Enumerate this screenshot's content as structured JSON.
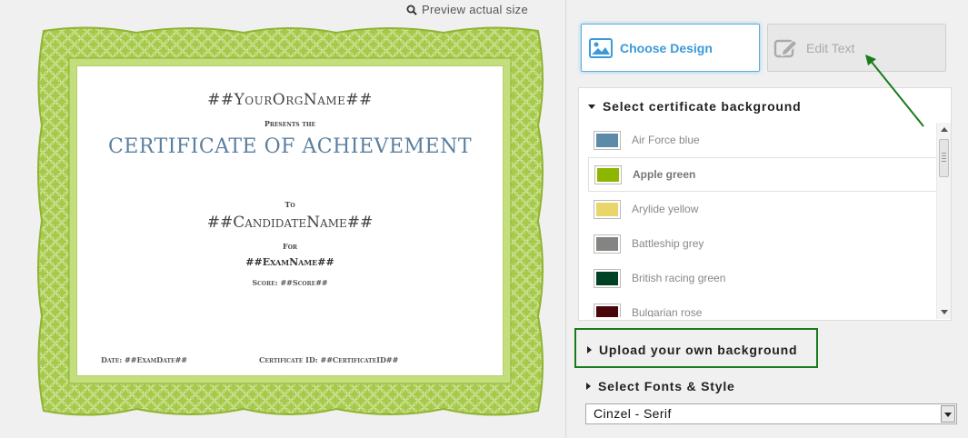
{
  "preview": {
    "link_label": "Preview actual size",
    "icon": "search-icon"
  },
  "certificate": {
    "org": "##YourOrgName##",
    "presents": "Presents the",
    "title": "Certificate of Achievement",
    "to": "To",
    "candidate": "##CandidateName##",
    "for": "For",
    "exam": "##ExamName##",
    "score": "Score: ##Score##",
    "date": "Date: ##ExamDate##",
    "certificate_id": "Certificate ID: ##CertificateID##",
    "border_color": "#9cc43a",
    "title_color": "#5b7fa0"
  },
  "toolbar": {
    "choose_design_label": "Choose Design",
    "choose_design_icon": "image-icon",
    "edit_text_label": "Edit Text",
    "edit_text_icon": "edit-icon"
  },
  "background_section": {
    "heading": "Select certificate background",
    "items": [
      {
        "label": "Air Force blue",
        "color": "#5d8aa8",
        "selected": false
      },
      {
        "label": "Apple green",
        "color": "#8db600",
        "selected": true
      },
      {
        "label": "Arylide yellow",
        "color": "#e9d66b",
        "selected": false
      },
      {
        "label": "Battleship grey",
        "color": "#848482",
        "selected": false
      },
      {
        "label": "British racing green",
        "color": "#004225",
        "selected": false
      },
      {
        "label": "Bulgarian rose",
        "color": "#48060a",
        "selected": false
      }
    ]
  },
  "upload_section": {
    "heading": "Upload your own background"
  },
  "fonts_section": {
    "heading": "Select Fonts & Style",
    "selected_font": "Cinzel - Serif"
  },
  "annotation": {
    "highlight_color": "#1b7a1b"
  }
}
